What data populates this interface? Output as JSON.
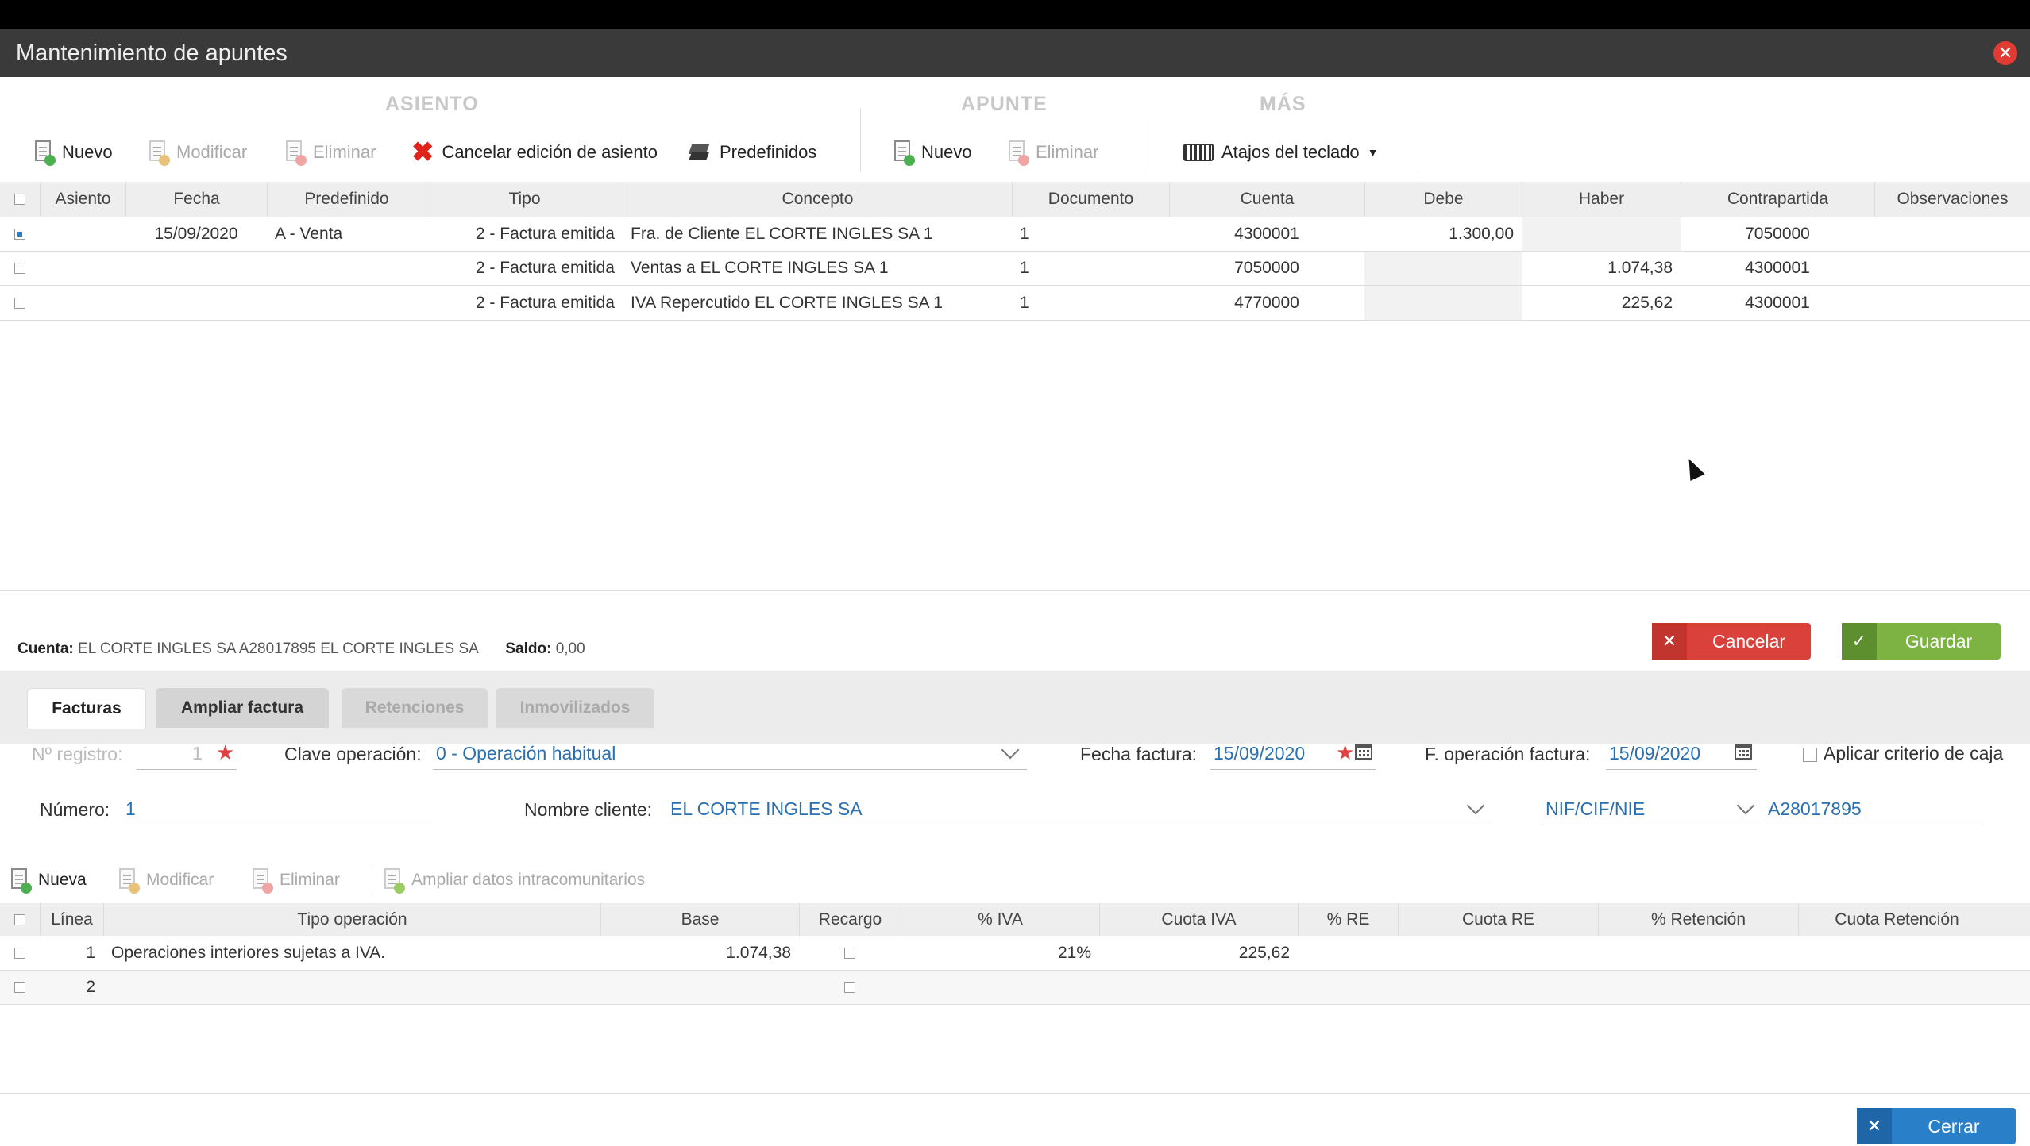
{
  "window": {
    "title": "Mantenimiento de apuntes"
  },
  "toolbar": {
    "groups": {
      "asiento": "ASIENTO",
      "apunte": "APUNTE",
      "mas": "MÁS"
    },
    "asiento": {
      "nuevo": "Nuevo",
      "modificar": "Modificar",
      "eliminar": "Eliminar",
      "cancelar": "Cancelar edición de asiento",
      "predefinidos": "Predefinidos"
    },
    "apunte": {
      "nuevo": "Nuevo",
      "eliminar": "Eliminar"
    },
    "mas": {
      "atajos": "Atajos del teclado"
    }
  },
  "grid": {
    "headers": [
      "Asiento",
      "Fecha",
      "Predefinido",
      "Tipo",
      "Concepto",
      "Documento",
      "Cuenta",
      "Debe",
      "Haber",
      "Contrapartida",
      "Observaciones"
    ],
    "rows": [
      {
        "selected": true,
        "asiento": "",
        "fecha": "15/09/2020",
        "predefinido": "A - Venta",
        "tipo": "2 - Factura emitida",
        "concepto": "Fra. de Cliente EL CORTE INGLES SA 1",
        "documento": "1",
        "cuenta": "4300001",
        "debe": "1.300,00",
        "haber": "",
        "contrapartida": "7050000",
        "observaciones": ""
      },
      {
        "selected": false,
        "asiento": "",
        "fecha": "",
        "predefinido": "",
        "tipo": "2 - Factura emitida",
        "concepto": "Ventas a EL CORTE INGLES SA 1",
        "documento": "1",
        "cuenta": "7050000",
        "debe": "",
        "haber": "1.074,38",
        "contrapartida": "4300001",
        "observaciones": ""
      },
      {
        "selected": false,
        "asiento": "",
        "fecha": "",
        "predefinido": "",
        "tipo": "2 - Factura emitida",
        "concepto": "IVA Repercutido EL CORTE INGLES SA 1",
        "documento": "1",
        "cuenta": "4770000",
        "debe": "",
        "haber": "225,62",
        "contrapartida": "4300001",
        "observaciones": ""
      }
    ]
  },
  "status": {
    "cuenta_label": "Cuenta:",
    "cuenta_value": "EL CORTE INGLES SA A28017895 EL CORTE INGLES SA",
    "saldo_label": "Saldo:",
    "saldo_value": "0,00"
  },
  "actions": {
    "cancelar": "Cancelar",
    "guardar": "Guardar",
    "cerrar": "Cerrar"
  },
  "tabs": [
    "Facturas",
    "Ampliar factura",
    "Retenciones",
    "Inmovilizados"
  ],
  "form": {
    "registro_label": "Nº registro:",
    "registro_value": "1",
    "clave_label": "Clave operación:",
    "clave_value": "0 -  Operación habitual",
    "fecha_label": "Fecha factura:",
    "fecha_value": "15/09/2020",
    "foper_label": "F. operación factura:",
    "foper_value": "15/09/2020",
    "criterio_label": "Aplicar criterio de caja",
    "numero_label": "Número:",
    "numero_value": "1",
    "nombre_label": "Nombre cliente:",
    "nombre_value": "EL CORTE INGLES SA",
    "nif_type": "NIF/CIF/NIE",
    "nif_value": "A28017895"
  },
  "subtoolbar": {
    "nueva": "Nueva",
    "modificar": "Modificar",
    "eliminar": "Eliminar",
    "ampliar": "Ampliar datos intracomunitarios"
  },
  "lines": {
    "headers": [
      "Línea",
      "Tipo operación",
      "Base",
      "Recargo",
      "% IVA",
      "Cuota IVA",
      "% RE",
      "Cuota RE",
      "% Retención",
      "Cuota Retención"
    ],
    "rows": [
      {
        "linea": "1",
        "tipo": "Operaciones interiores sujetas a IVA.",
        "base": "1.074,38",
        "iva": "21%",
        "cuota": "225,62"
      },
      {
        "linea": "2",
        "tipo": "",
        "base": "",
        "iva": "",
        "cuota": ""
      }
    ]
  },
  "colors": {
    "accent": "#2a6fb0",
    "danger": "#d9413a",
    "success": "#7cb342",
    "primary": "#2a7fc9"
  }
}
